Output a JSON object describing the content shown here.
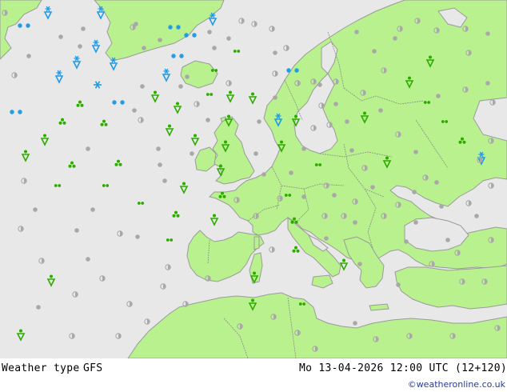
{
  "footer": {
    "product": "Weather type",
    "model": "GFS",
    "datetime": "Mo 13-04-2026 12:00 UTC (12+120)",
    "credit": "©weatheronline.co.uk"
  },
  "colors": {
    "sea": "#e8e8e8",
    "land": "#b8f18e",
    "coast": "#9a9a9a",
    "border": "#888888",
    "rain": "#2eaa00",
    "snow": "#1e9be6",
    "dry": "#a8a8a8"
  },
  "legend_symbols": [
    "rain-shower",
    "rain-light",
    "rain-moderate",
    "snow-shower",
    "snow-light",
    "cloudy",
    "partly-cloudy",
    "sunny"
  ]
}
